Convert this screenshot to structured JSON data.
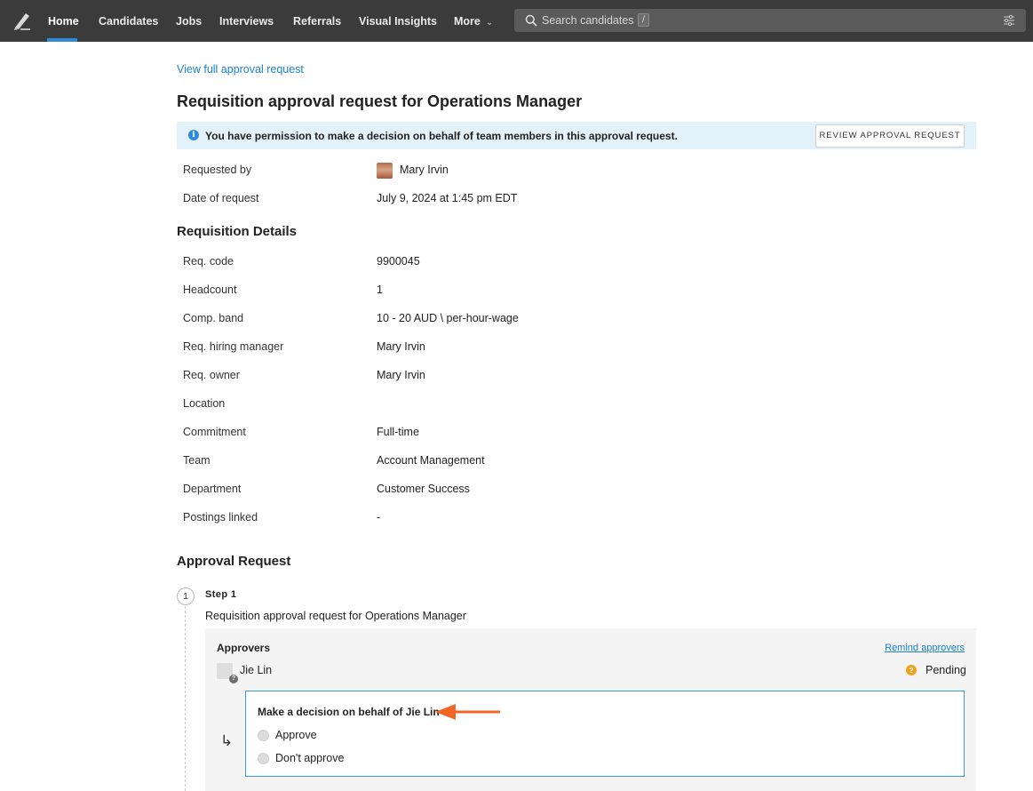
{
  "nav": {
    "items": [
      {
        "label": "Home",
        "active": true
      },
      {
        "label": "Candidates"
      },
      {
        "label": "Jobs"
      },
      {
        "label": "Interviews"
      },
      {
        "label": "Referrals"
      },
      {
        "label": "Visual Insights"
      },
      {
        "label": "More"
      }
    ],
    "search": {
      "placeholder": "Search candidates",
      "shortcut": "/"
    },
    "icons": {
      "logo": "pen-logo-icon",
      "search": "search-icon",
      "filter": "sliders-icon",
      "more": "chevron-down-icon"
    }
  },
  "page": {
    "view_link": "View full approval request",
    "title": "Requisition approval request for Operations Manager",
    "banner": {
      "text": "You have permission to make a decision on behalf of team members in this approval request.",
      "button": "REVIEW APPROVAL REQUEST"
    },
    "requested_by_label": "Requested by",
    "requested_by": "Mary Irvin",
    "date_label": "Date of request",
    "date": "July 9, 2024 at 1:45 pm EDT"
  },
  "requisition": {
    "title": "Requisition Details",
    "rows": [
      {
        "label": "Req. code",
        "value": "9900045"
      },
      {
        "label": "Headcount",
        "value": "1"
      },
      {
        "label": "Comp. band",
        "value": "10 - 20 AUD \\ per-hour-wage"
      },
      {
        "label": "Req. hiring manager",
        "value": "Mary Irvin"
      },
      {
        "label": "Req. owner",
        "value": "Mary Irvin"
      },
      {
        "label": "Location",
        "value": ""
      },
      {
        "label": "Commitment",
        "value": "Full-time"
      },
      {
        "label": "Team",
        "value": "Account Management"
      },
      {
        "label": "Department",
        "value": "Customer Success"
      },
      {
        "label": "Postings linked",
        "value": "-"
      }
    ]
  },
  "approval": {
    "title": "Approval Request",
    "step_number": "1",
    "step_label": "Step 1",
    "step_description": "Requisition approval request for Operations Manager",
    "approvers_title": "Approvers",
    "remind_link": "Remind approvers",
    "approver_name": "Jie Lin",
    "status": "Pending",
    "decision_title": "Make a decision on behalf of Jie Lin",
    "options": [
      "Approve",
      "Don't approve"
    ]
  },
  "colors": {
    "nav_bg": "#3b3b3b",
    "accent": "#2e8ad8",
    "link": "#1a82cf",
    "banner_bg": "#e3f1fb",
    "pending": "#f0a21c",
    "annotation_arrow": "#f26522"
  }
}
